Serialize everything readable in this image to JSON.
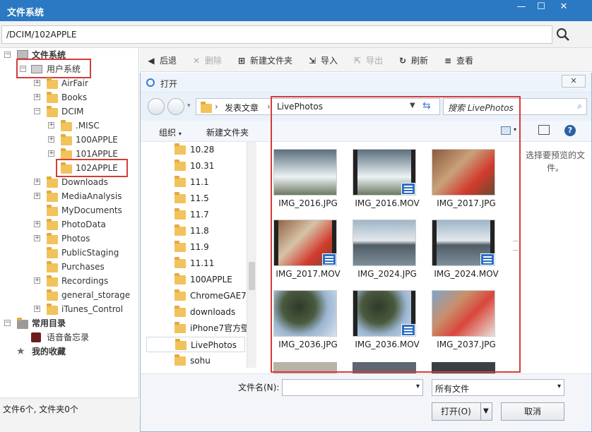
{
  "window": {
    "title": "文件系统"
  },
  "path": {
    "value": "/DCIM/102APPLE"
  },
  "tree": {
    "root": "文件系统",
    "user_system": "用户系统",
    "items": [
      "AirFair",
      "Books",
      "DCIM",
      ".MISC",
      "100APPLE",
      "101APPLE",
      "102APPLE",
      "Downloads",
      "MediaAnalysis",
      "MyDocuments",
      "PhotoData",
      "Photos",
      "PublicStaging",
      "Purchases",
      "Recordings",
      "general_storage",
      "iTunes_Control"
    ],
    "common_dirs": "常用目录",
    "voice_memo": "语音备忘录",
    "favorites": "我的收藏"
  },
  "status": {
    "text": "文件6个, 文件夹0个"
  },
  "toolbar": {
    "back": "后退",
    "delete": "删除",
    "new_folder": "新建文件夹",
    "import": "导入",
    "export": "导出",
    "refresh": "刷新",
    "view": "查看"
  },
  "dialog": {
    "title": "打开",
    "breadcrumb": [
      "发表文章",
      "LivePhotos"
    ],
    "search_placeholder": "搜索 LivePhotos",
    "organize": "组织",
    "new_folder": "新建文件夹",
    "nav": [
      "10.28",
      "10.31",
      "11.1",
      "11.5",
      "11.7",
      "11.8",
      "11.9",
      "11.11",
      "100APPLE",
      "ChromeGAE7.",
      "downloads",
      "iPhone7官方壁",
      "LivePhotos",
      "sohu"
    ],
    "files": [
      "IMG_2016.JPG",
      "IMG_2016.MOV",
      "IMG_2017.JPG",
      "IMG_2017.MOV",
      "IMG_2024.JPG",
      "IMG_2024.MOV",
      "IMG_2036.JPG",
      "IMG_2036.MOV",
      "IMG_2037.JPG"
    ],
    "preview_text": "选择要预览的文件。",
    "filename_label": "文件名(N):",
    "filename_value": "",
    "filetype": "所有文件",
    "open": "打开(O)",
    "cancel": "取消"
  },
  "colors": {
    "titlebar": "#2b79c2",
    "highlight": "#d63b3b",
    "folder": "#f1c35b"
  }
}
